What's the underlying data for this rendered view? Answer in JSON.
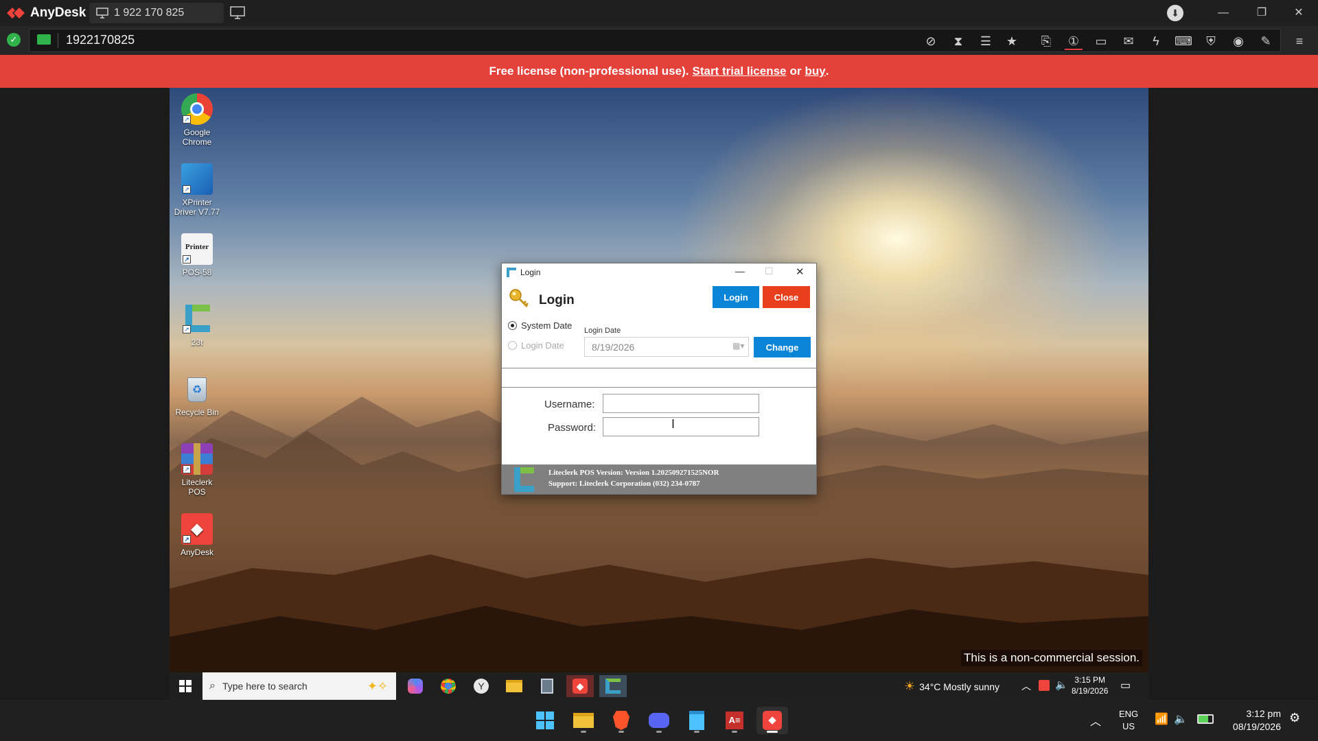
{
  "anydesk": {
    "app_name": "AnyDesk",
    "tab_label": "1 922 170 825",
    "address_value": "1922170825"
  },
  "banner": {
    "prefix": "Free license (non-professional use).",
    "trial_link": "Start trial license",
    "or_text": "or",
    "buy_link": "buy",
    "suffix": "."
  },
  "desktop_icons": [
    {
      "label": "Google Chrome"
    },
    {
      "label": "XPrinter Driver V7.77"
    },
    {
      "label": "POS-58",
      "img_text": "Printer"
    },
    {
      "label": "23t"
    },
    {
      "label": "Recycle Bin"
    },
    {
      "label": "Liteclerk POS"
    },
    {
      "label": "AnyDesk"
    }
  ],
  "dialog": {
    "window_title": "Login",
    "heading": "Login",
    "login_button": "Login",
    "close_button": "Close",
    "radio_system_date": "System Date",
    "radio_login_date": "Login Date",
    "login_date_label": "Login Date",
    "login_date_value": "8/19/2026",
    "change_button": "Change",
    "username_label": "Username:",
    "password_label": "Password:",
    "username_value": "",
    "password_value": "",
    "footer_version": "Liteclerk POS Version: Version 1.202509271525NOR",
    "footer_support": "Support: Liteclerk Corporation (032) 234-0787",
    "accent_blue": "#0a84d6",
    "accent_red": "#e8401c"
  },
  "remote_taskbar": {
    "search_placeholder": "Type here to search",
    "weather": "34°C  Mostly sunny",
    "time": "3:15 PM",
    "date": "8/19/2026"
  },
  "watermark": "This is a non-commercial session.",
  "local_taskbar": {
    "lang_line1": "ENG",
    "lang_line2": "US",
    "time": "3:12 pm",
    "date": "08/19/2026"
  }
}
